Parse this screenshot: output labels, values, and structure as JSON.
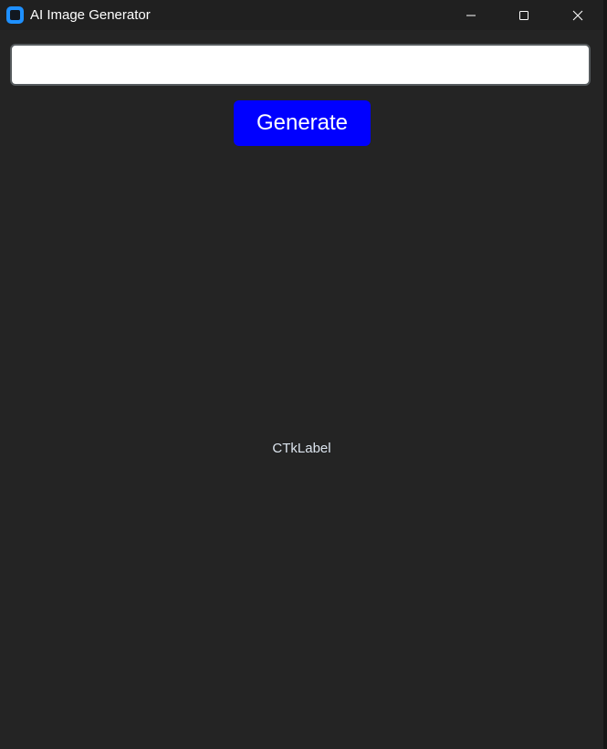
{
  "window": {
    "title": "AI Image Generator",
    "icon": "app-icon",
    "controls": {
      "minimize_icon": "minimize-icon",
      "maximize_icon": "maximize-icon",
      "close_icon": "close-icon"
    }
  },
  "prompt_input": {
    "value": "",
    "placeholder": ""
  },
  "generate_button": {
    "label": "Generate",
    "color": "#0000ff"
  },
  "image_label": {
    "text": "CTkLabel"
  },
  "colors": {
    "background": "#242424",
    "title_bar": "#202020",
    "accent": "#0000ff"
  }
}
